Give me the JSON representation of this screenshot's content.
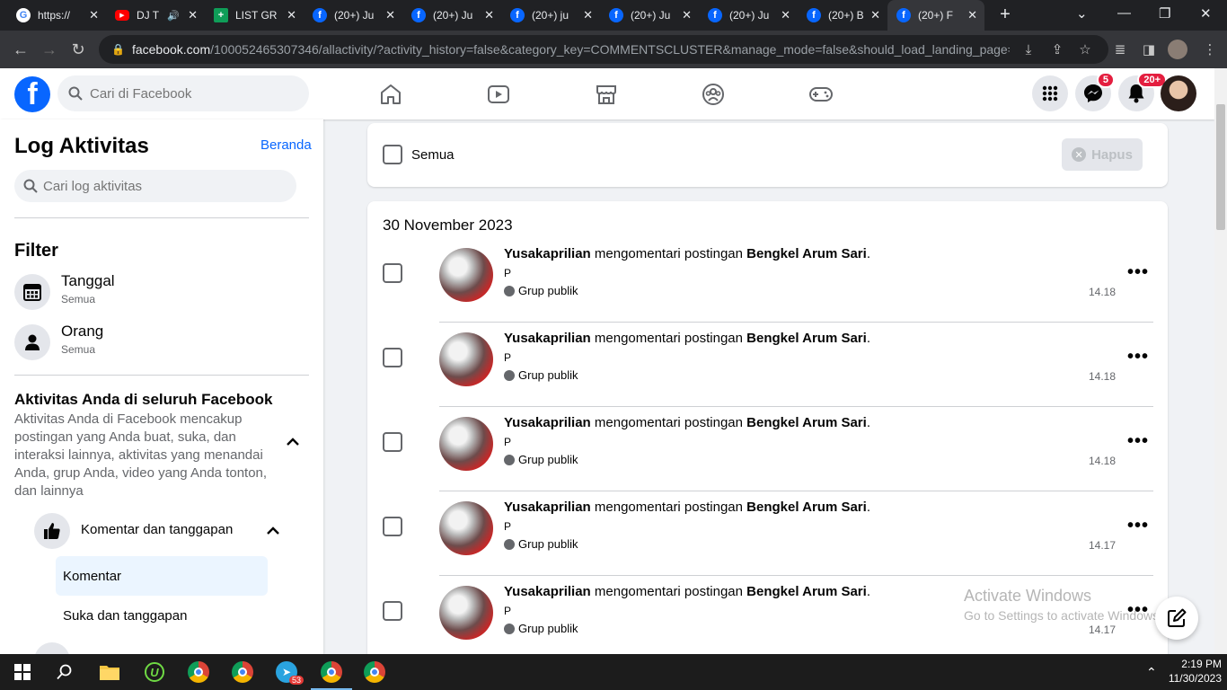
{
  "browser": {
    "tabs": [
      {
        "title": "https://",
        "icon": "google-icon",
        "active": false
      },
      {
        "title": "DJ T",
        "icon": "youtube-icon",
        "active": false
      },
      {
        "title": "LIST GR",
        "icon": "sheets-icon",
        "active": false
      },
      {
        "title": "(20+) Ju",
        "icon": "facebook-icon",
        "active": false
      },
      {
        "title": "(20+) Ju",
        "icon": "facebook-icon",
        "active": false
      },
      {
        "title": "(20+) ju",
        "icon": "facebook-icon",
        "active": false
      },
      {
        "title": "(20+) Ju",
        "icon": "facebook-icon",
        "active": false
      },
      {
        "title": "(20+) Ju",
        "icon": "facebook-icon",
        "active": false
      },
      {
        "title": "(20+) B",
        "icon": "facebook-icon",
        "active": false
      },
      {
        "title": "(20+) F",
        "icon": "facebook-icon",
        "active": true
      }
    ],
    "url_host": "facebook.com",
    "url_path": "/100052465307346/allactivity/?activity_history=false&category_key=COMMENTSCLUSTER&manage_mode=false&should_load_landing_page=f..."
  },
  "header": {
    "search_placeholder": "Cari di Facebook",
    "messenger_badge": "5",
    "notifications_badge": "20+"
  },
  "sidebar": {
    "title": "Log Aktivitas",
    "home_link": "Beranda",
    "search_placeholder": "Cari log aktivitas",
    "filter_heading": "Filter",
    "filters": [
      {
        "label": "Tanggal",
        "value": "Semua",
        "icon": "calendar-icon"
      },
      {
        "label": "Orang",
        "value": "Semua",
        "icon": "person-icon"
      }
    ],
    "section_title": "Aktivitas Anda di seluruh Facebook",
    "section_desc": "Aktivitas Anda di Facebook mencakup postingan yang Anda buat, suka, dan interaksi lainnya, aktivitas yang menandai Anda, grup Anda, video yang Anda tonton, dan lainnya",
    "category": "Komentar dan tanggapan",
    "sub_items": [
      "Komentar",
      "Suka dan tanggapan"
    ]
  },
  "main": {
    "select_all_label": "Semua",
    "delete_label": "Hapus",
    "date_heading": "30 November 2023",
    "activities": [
      {
        "actor": "Yusakaprilian",
        "action": " mengomentari postingan ",
        "target": "Bengkel Arum Sari",
        "end": ".",
        "comment": "P",
        "audience": "Grup publik",
        "time": "14.18"
      },
      {
        "actor": "Yusakaprilian",
        "action": " mengomentari postingan ",
        "target": "Bengkel Arum Sari",
        "end": ".",
        "comment": "P",
        "audience": "Grup publik",
        "time": "14.18"
      },
      {
        "actor": "Yusakaprilian",
        "action": " mengomentari postingan ",
        "target": "Bengkel Arum Sari",
        "end": ".",
        "comment": "P",
        "audience": "Grup publik",
        "time": "14.18"
      },
      {
        "actor": "Yusakaprilian",
        "action": " mengomentari postingan ",
        "target": "Bengkel Arum Sari",
        "end": ".",
        "comment": "P",
        "audience": "Grup publik",
        "time": "14.17"
      },
      {
        "actor": "Yusakaprilian",
        "action": " mengomentari postingan ",
        "target": "Bengkel Arum Sari",
        "end": ".",
        "comment": "P",
        "audience": "Grup publik",
        "time": "14.17"
      }
    ]
  },
  "watermark": {
    "line1": "Activate Windows",
    "line2": "Go to Settings to activate Windows."
  },
  "taskbar": {
    "telegram_badge": "53",
    "time": "2:19 PM",
    "date": "11/30/2023"
  },
  "colors": {
    "facebook_blue": "#0866ff",
    "badge_red": "#e41e3f",
    "selected_bg": "#ebf5ff"
  }
}
